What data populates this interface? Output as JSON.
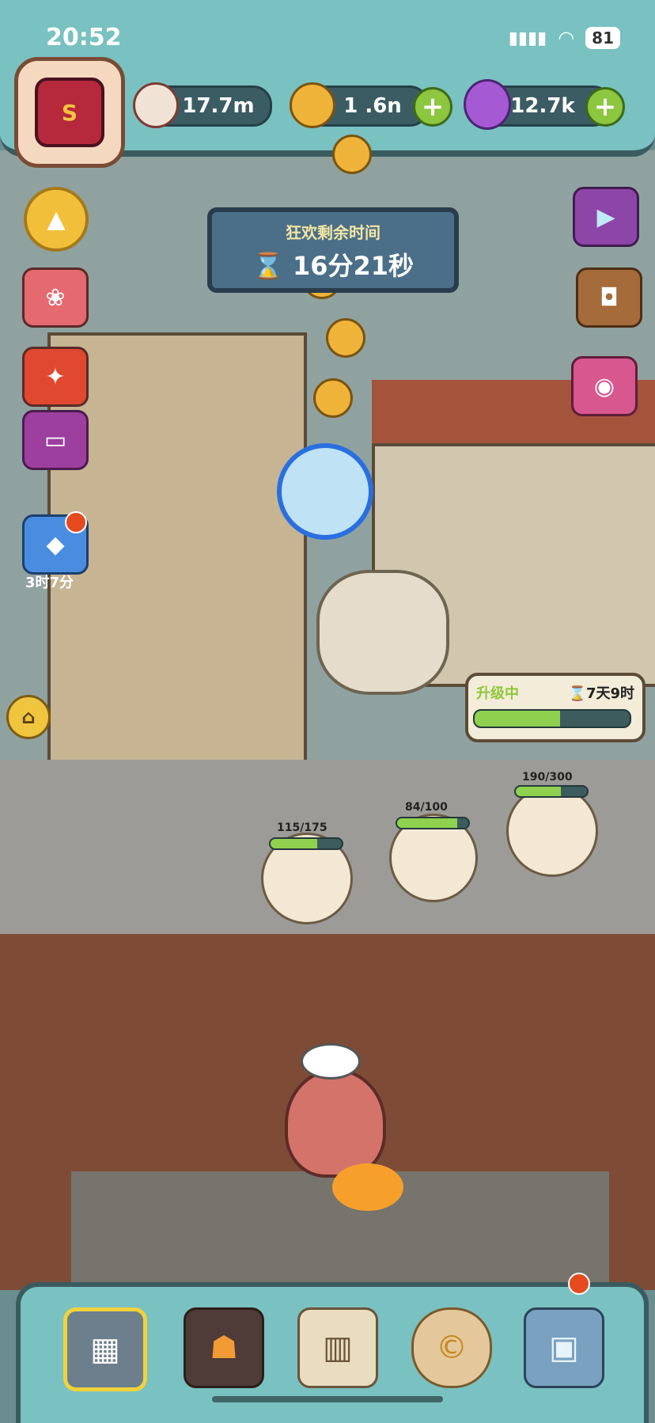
{
  "status": {
    "time": "20:52",
    "battery": "81"
  },
  "resources": {
    "eyes": "17.7m",
    "coins": "1  .6n",
    "potion": "12.7k"
  },
  "event": {
    "title": "狂欢剩余时间",
    "time": "16分21秒"
  },
  "side": {
    "gift_timer": "3时7分"
  },
  "upgrade": {
    "label": "升级中",
    "time": "7天9时",
    "progress": 0.55
  },
  "stations": [
    {
      "label": "115/175",
      "progress": 0.66
    },
    {
      "label": "84/100",
      "progress": 0.84
    },
    {
      "label": "190/300",
      "progress": 0.63
    }
  ],
  "colors": {
    "accent_green": "#8dc63f",
    "hud_teal": "#7ac1c1",
    "coin_gold": "#f0b33a"
  }
}
